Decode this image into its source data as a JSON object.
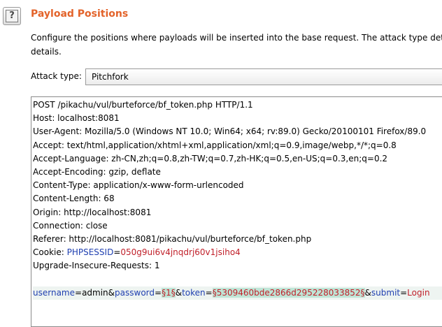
{
  "header": {
    "help_icon": "question-icon",
    "help_glyph": "?",
    "title": "Payload Positions",
    "description": "Configure the positions where payloads will be inserted into the base request. The attack type determi details."
  },
  "attack": {
    "label": "Attack type:",
    "selected": "Pitchfork"
  },
  "request": {
    "lines": [
      "POST /pikachu/vul/burteforce/bf_token.php HTTP/1.1",
      "Host: localhost:8081",
      "User-Agent: Mozilla/5.0 (Windows NT 10.0; Win64; x64; rv:89.0) Gecko/20100101 Firefox/89.0",
      "Accept: text/html,application/xhtml+xml,application/xml;q=0.9,image/webp,*/*;q=0.8",
      "Accept-Language: zh-CN,zh;q=0.8,zh-TW;q=0.7,zh-HK;q=0.5,en-US;q=0.3,en;q=0.2",
      "Accept-Encoding: gzip, deflate",
      "Content-Type: application/x-www-form-urlencoded",
      "Content-Length: 68",
      "Origin: http://localhost:8081",
      "Connection: close",
      "Referer: http://localhost:8081/pikachu/vul/burteforce/bf_token.php"
    ],
    "cookie": {
      "prefix": "Cookie: ",
      "name": "PHPSESSID",
      "eq": "=",
      "value": "050g9ui6v4jnqdrj60v1jsiho4"
    },
    "upgrade_line": "Upgrade-Insecure-Requests: 1",
    "body": {
      "p1_name": "username",
      "eq1": "=",
      "p1_value": "admin",
      "amp1": "&",
      "p2_name": "password",
      "eq2": "=",
      "p2_marked": "§1§",
      "amp2": "&",
      "p3_name": "token",
      "eq3": "=",
      "p3_marked": "§5309460bde2866d295228033852§",
      "amp3": "&",
      "p4_name": "submit",
      "eq4": "=",
      "p4_value": "Login"
    }
  },
  "colors": {
    "title": "#e3632a",
    "param_name": "#1f3fb0",
    "param_value": "#c0202a",
    "payload_marker_bg": "#bfe5d6",
    "payload_line_bg": "#eef4f1"
  }
}
